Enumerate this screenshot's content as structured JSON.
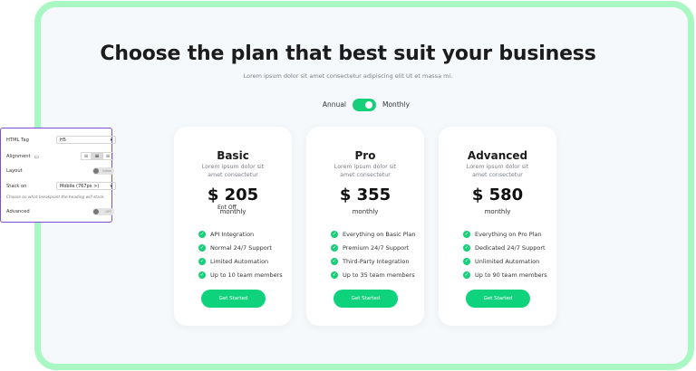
{
  "page": {
    "title": "Choose the plan that best suit your business",
    "subtitle": "Lorem ipsum dolor sit amet consectetur adipiscing elit Ut et massa mi."
  },
  "billing_toggle": {
    "annual_label": "Annual",
    "monthly_label": "Monthly",
    "state": "monthly"
  },
  "plans": [
    {
      "name": "Basic",
      "description": "Lorem ipsum dolor sit amet consectetur",
      "price": "$ 205",
      "period": "monthly",
      "features": [
        "API Integration",
        "Normal 24/7 Support",
        "Limited Automation",
        "Up to 10 team members"
      ],
      "button": "Get Started"
    },
    {
      "name": "Pro",
      "description": "Lorem ipsum dolor sit amet consectetur",
      "price": "$ 355",
      "period": "monthly",
      "features": [
        "Everything on Basic Plan",
        "Premium 24/7 Support",
        "Third-Party Integration",
        "Up to 35 team members"
      ],
      "button": "Get Started"
    },
    {
      "name": "Advanced",
      "description": "Lorem ipsum dolor sit amet consectetur",
      "price": "$ 580",
      "period": "monthly",
      "features": [
        "Everything on Pro Plan",
        "Dedicated 24/7 Support",
        "Unlimited Automation",
        "Up to 90 team members"
      ],
      "button": "Get Started"
    }
  ],
  "overlay_tag": "Ent Off",
  "settings_panel": {
    "html_tag_label": "HTML Tag",
    "html_tag_value": "H5",
    "alignment_label": "Alignment",
    "layout_label": "Layout",
    "layout_toggle": "Inline",
    "stack_on_label": "Stack on",
    "stack_on_value": "Mobile (767px >)",
    "stack_note": "Choose on what breakpoint the heading will stack.",
    "advanced_label": "Advanced",
    "advanced_toggle": "OFF"
  },
  "colors": {
    "accent": "#17cf78",
    "frame_border": "#a9f7c3",
    "panel_border": "#7b4fd8"
  }
}
